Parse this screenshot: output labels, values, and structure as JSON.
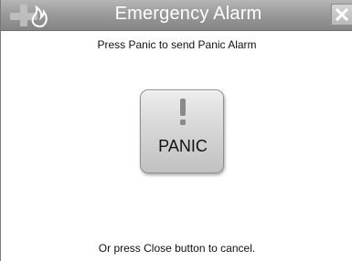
{
  "window": {
    "title": "Emergency Alarm",
    "title_icons": [
      "medical-cross-icon",
      "fire-icon"
    ],
    "close_icon": "close-icon"
  },
  "content": {
    "instruction": "Press Panic to send Panic Alarm",
    "panic_button": {
      "icon": "exclamation-icon",
      "label": "PANIC"
    },
    "cancel_hint": "Or press Close button to cancel."
  },
  "colors": {
    "titlebar": "#9b9b9b",
    "title_text": "#ffffff",
    "background": "#ffffff",
    "button_face": "#d7d7d7",
    "icon_gray": "#8a8a8a"
  }
}
